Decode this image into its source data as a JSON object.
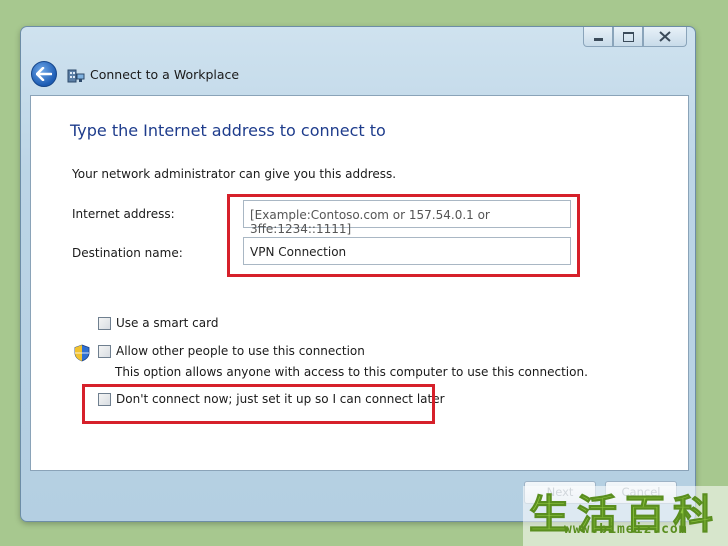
{
  "window": {
    "title": "Connect to a Workplace",
    "caption_buttons": [
      "minimize",
      "maximize",
      "close"
    ]
  },
  "page": {
    "heading": "Type the Internet address to connect to",
    "intro": "Your network administrator can give you this address.",
    "internet_address": {
      "label": "Internet address:",
      "placeholder": "[Example:Contoso.com or 157.54.0.1 or 3ffe:1234::1111]"
    },
    "destination_name": {
      "label": "Destination name:",
      "value": "VPN Connection"
    },
    "options": {
      "smart_card": "Use a smart card",
      "allow_others": "Allow other people to use this connection",
      "allow_others_hint": "This option allows anyone with access to this computer to use this connection.",
      "dont_connect": "Don't connect now; just set it up so I can connect later"
    }
  },
  "footer": {
    "next_label": "Next",
    "cancel_label": "Cancel"
  },
  "watermark": {
    "chars": "生活百科",
    "url": "www.bimeiz.com"
  },
  "colors": {
    "highlight": "#d6202a",
    "heading": "#1e3c8c",
    "background": "#a7c88f"
  }
}
